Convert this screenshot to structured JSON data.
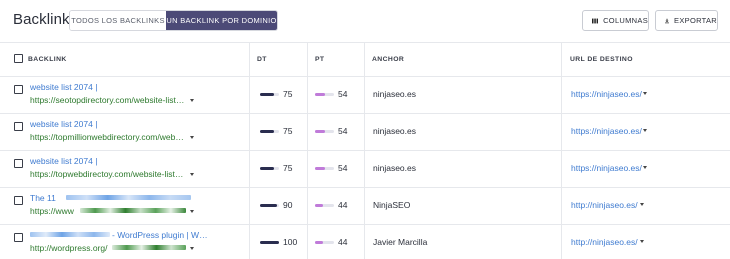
{
  "header": {
    "title": "Backlinks",
    "tabs": [
      {
        "label": "TODOS LOS BACKLINKS",
        "active": false
      },
      {
        "label": "UN BACKLINK POR DOMINIO",
        "active": true
      }
    ],
    "columns_label": "COLUMNAS",
    "export_label": "EXPORTAR"
  },
  "table": {
    "columns": [
      "BACKLINK",
      "DT",
      "PT",
      "ANCHOR",
      "URL DE DESTINO"
    ],
    "rows": [
      {
        "title": "website list 2074 |",
        "url": "https://seotopdirectory.com/website-list…",
        "dt": 75,
        "pt": 54,
        "anchor": "ninjaseo.es",
        "target": "https://ninjaseo.es/"
      },
      {
        "title": "website list 2074 |",
        "url": "https://topmillionwebdirectory.com/web…",
        "dt": 75,
        "pt": 54,
        "anchor": "ninjaseo.es",
        "target": "https://ninjaseo.es/"
      },
      {
        "title": "website list 2074 |",
        "url": "https://topwebdirectoy.com/website-list…",
        "dt": 75,
        "pt": 54,
        "anchor": "ninjaseo.es",
        "target": "https://ninjaseo.es/"
      },
      {
        "title": "The 11",
        "url": "https://www",
        "dt": 90,
        "pt": 44,
        "anchor": "NinjaSEO",
        "target": "http://ninjaseo.es/"
      },
      {
        "title": "- WordPress plugin | W…",
        "url": "http://wordpress.org/",
        "dt": 100,
        "pt": 44,
        "anchor": "Javier Marcilla",
        "target": "http://ninjaseo.es/"
      }
    ]
  },
  "colors": {
    "accent": "#4c4a77",
    "link": "#3f7bd0",
    "url_green": "#2e7a2e",
    "dt_bar": "#2a2d4f",
    "pt_bar": "#c07bd9"
  }
}
